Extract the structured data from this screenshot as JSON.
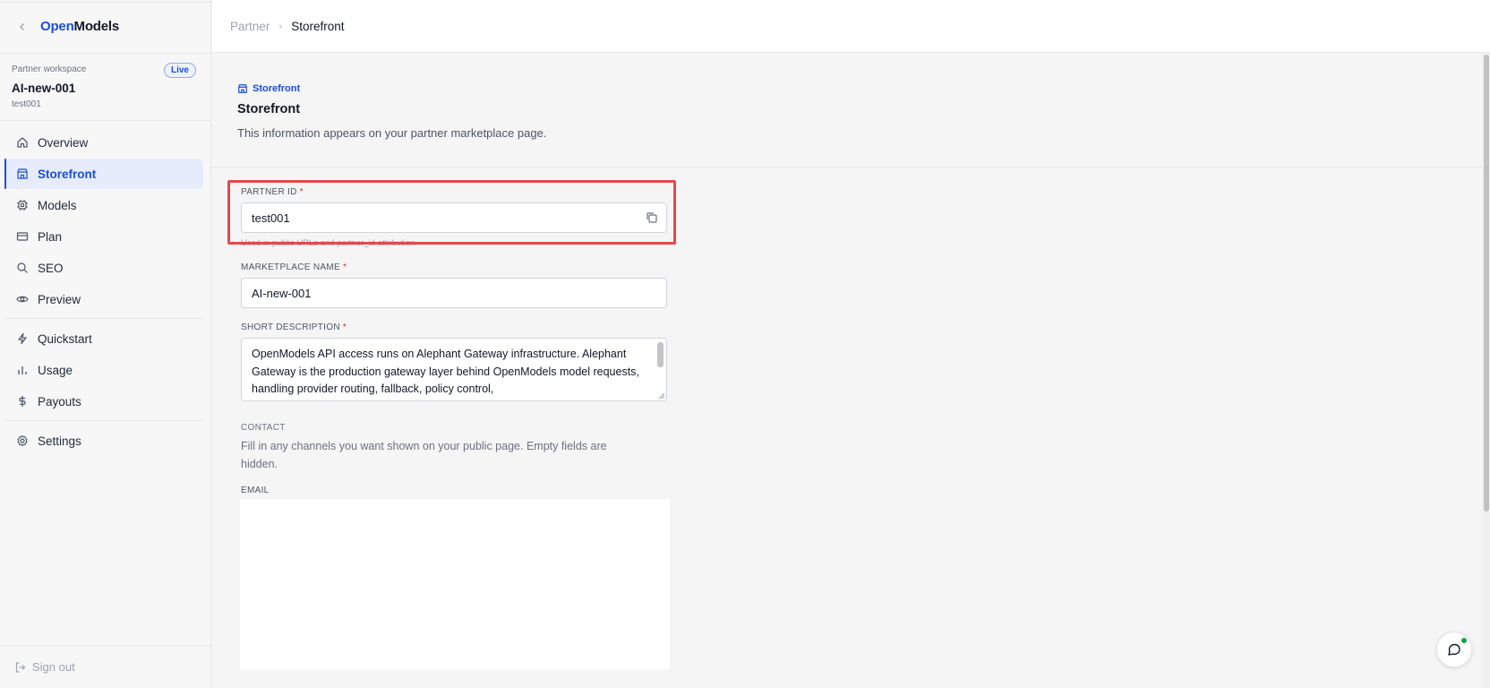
{
  "brand": {
    "open": "Open",
    "models": "Models"
  },
  "workspace": {
    "label": "Partner workspace",
    "badge": "Live",
    "name": "AI-new-001",
    "id": "test001"
  },
  "nav": {
    "items": [
      {
        "label": "Overview",
        "icon": "home-icon"
      },
      {
        "label": "Storefront",
        "icon": "store-icon",
        "active": true
      },
      {
        "label": "Models",
        "icon": "cpu-icon"
      },
      {
        "label": "Plan",
        "icon": "credit-card-icon"
      },
      {
        "label": "SEO",
        "icon": "search-icon"
      },
      {
        "label": "Preview",
        "icon": "eye-icon"
      }
    ],
    "items2": [
      {
        "label": "Quickstart",
        "icon": "zap-icon"
      },
      {
        "label": "Usage",
        "icon": "bar-chart-icon"
      },
      {
        "label": "Payouts",
        "icon": "dollar-icon"
      }
    ],
    "items3": [
      {
        "label": "Settings",
        "icon": "gear-icon"
      }
    ]
  },
  "signout": "Sign out",
  "breadcrumb": {
    "parent": "Partner",
    "current": "Storefront"
  },
  "header": {
    "eyebrow": "Storefront",
    "title": "Storefront",
    "description": "This information appears on your partner marketplace page."
  },
  "form": {
    "partner_id": {
      "label": "PARTNER ID",
      "required": "*",
      "value": "test001",
      "hint": "Used in public URLs and partner_id attribution."
    },
    "marketplace_name": {
      "label": "MARKETPLACE NAME",
      "required": "*",
      "value": "AI-new-001"
    },
    "short_description": {
      "label": "SHORT DESCRIPTION",
      "required": "*",
      "value": "OpenModels API access runs on Alephant Gateway infrastructure. Alephant Gateway is the production gateway layer behind OpenModels model requests, handling provider routing, fallback, policy control,"
    },
    "contact": {
      "label": "CONTACT",
      "description": "Fill in any channels you want shown on your public page. Empty fields are hidden."
    },
    "email": {
      "label": "EMAIL"
    }
  },
  "colors": {
    "accent": "#1d4ed8",
    "highlight": "#e5484d",
    "live_dot": "#16a34a"
  }
}
